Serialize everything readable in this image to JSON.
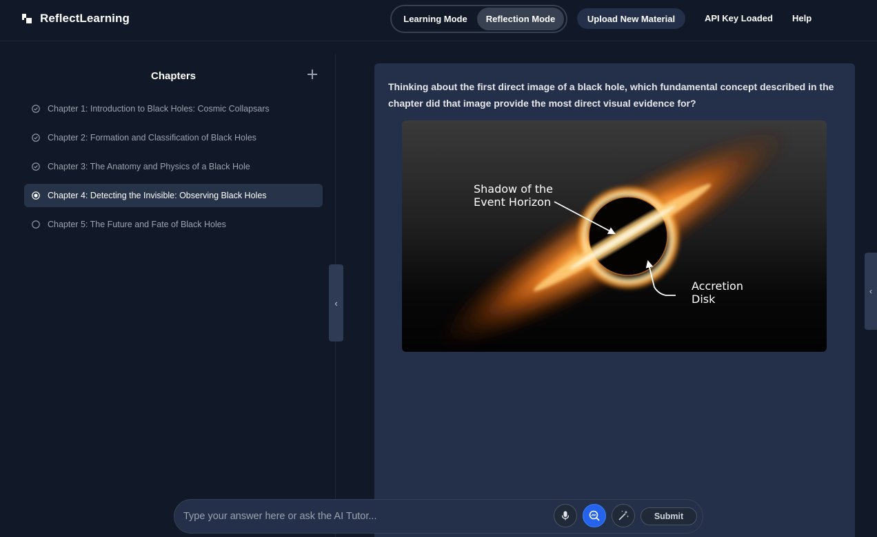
{
  "app": {
    "title": "ReflectLearning"
  },
  "header": {
    "learning_mode": "Learning Mode",
    "reflection_mode": "Reflection Mode",
    "active_mode": "Reflection Mode",
    "upload": "Upload New Material",
    "api_status": "API Key Loaded",
    "help": "Help"
  },
  "sidebar": {
    "title": "Chapters",
    "chapters": [
      {
        "label": "Chapter 1: Introduction to Black Holes: Cosmic Collapsars",
        "status": "completed"
      },
      {
        "label": "Chapter 2: Formation and Classification of Black Holes",
        "status": "completed"
      },
      {
        "label": "Chapter 3: The Anatomy and Physics of a Black Hole",
        "status": "completed"
      },
      {
        "label": "Chapter 4: Detecting the Invisible: Observing Black Holes",
        "status": "current"
      },
      {
        "label": "Chapter 5: The Future and Fate of Black Holes",
        "status": "pending"
      }
    ]
  },
  "main": {
    "question": "Thinking about the first direct image of a black hole, which fundamental concept described in the chapter did that image provide the most direct visual evidence for?",
    "figure": {
      "label_shadow_1": "Shadow of the",
      "label_shadow_2": "Event Horizon",
      "label_disk_1": "Accretion",
      "label_disk_2": "Disk"
    }
  },
  "input": {
    "placeholder": "Type your answer here or ask the AI Tutor...",
    "submit": "Submit"
  },
  "colors": {
    "accent": "#2563eb",
    "background": "#111827",
    "card": "#243049"
  }
}
